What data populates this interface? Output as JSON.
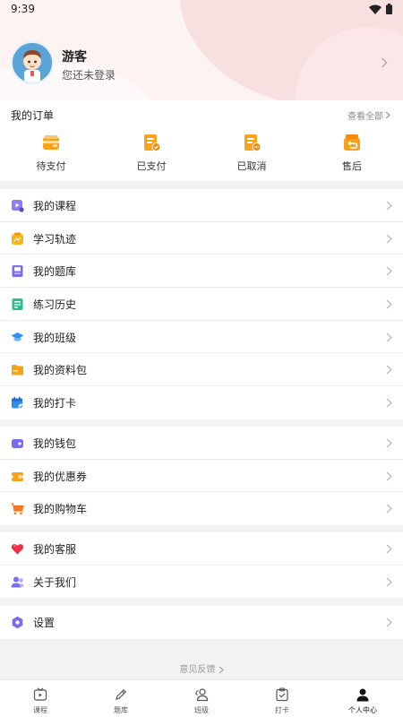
{
  "status": {
    "time": "9:39"
  },
  "profile": {
    "name": "游客",
    "subtitle": "您还未登录"
  },
  "orders": {
    "title": "我的订单",
    "view_all": "查看全部",
    "items": [
      {
        "label": "待支付",
        "icon": "wallet-icon"
      },
      {
        "label": "已支付",
        "icon": "paid-receipt-icon"
      },
      {
        "label": "已取消",
        "icon": "cancelled-receipt-icon"
      },
      {
        "label": "售后",
        "icon": "return-box-icon"
      }
    ]
  },
  "menu1": [
    {
      "label": "我的课程",
      "icon": "course-play-icon"
    },
    {
      "label": "学习轨迹",
      "icon": "study-track-icon"
    },
    {
      "label": "我的题库",
      "icon": "question-bank-icon"
    },
    {
      "label": "练习历史",
      "icon": "practice-history-icon"
    },
    {
      "label": "我的班级",
      "icon": "graduation-cap-icon"
    },
    {
      "label": "我的资料包",
      "icon": "folder-icon"
    },
    {
      "label": "我的打卡",
      "icon": "calendar-check-icon"
    }
  ],
  "menu2": [
    {
      "label": "我的钱包",
      "icon": "wallet-purple-icon"
    },
    {
      "label": "我的优惠券",
      "icon": "coupon-icon"
    },
    {
      "label": "我的购物车",
      "icon": "cart-icon"
    }
  ],
  "menu3": [
    {
      "label": "我的客服",
      "icon": "heart-icon"
    },
    {
      "label": "关于我们",
      "icon": "about-users-icon"
    }
  ],
  "menu4": [
    {
      "label": "设置",
      "icon": "settings-hex-icon"
    }
  ],
  "feedback": "意见反馈",
  "tabs": [
    {
      "label": "课程",
      "icon": "course-tab-icon",
      "active": false
    },
    {
      "label": "题库",
      "icon": "pencil-tab-icon",
      "active": false
    },
    {
      "label": "班级",
      "icon": "class-tab-icon",
      "active": false
    },
    {
      "label": "打卡",
      "icon": "checkin-tab-icon",
      "active": false
    },
    {
      "label": "个人中心",
      "icon": "person-tab-icon",
      "active": true
    }
  ],
  "colors": {
    "accent_orange": "#f7a21b",
    "header_pink": "#f6d8da",
    "chevron_gray": "#bbbbbb"
  }
}
